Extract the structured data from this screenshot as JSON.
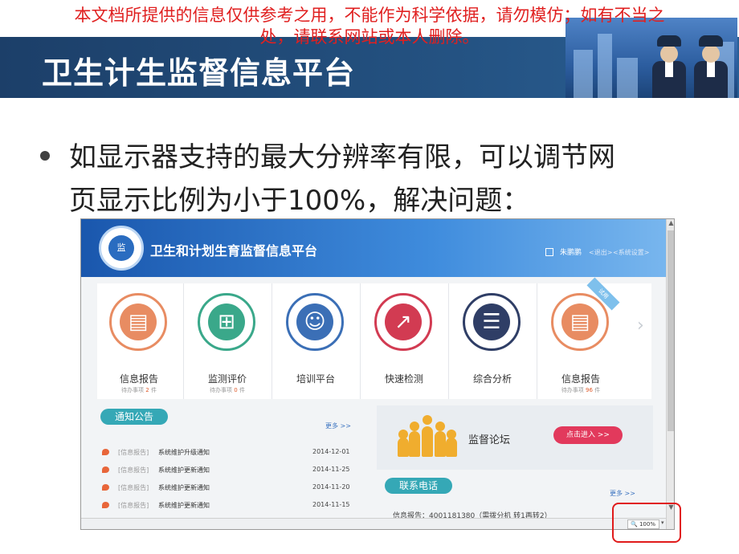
{
  "slide": {
    "disclaimer_line1": "本文档所提供的信息仅供参考之用，不能作为科学依据，请勿模仿；如有不当之",
    "disclaimer_line2": "处，请联系网站或本人删除。",
    "title": "卫生计生监督信息平台",
    "bullet_line1": "如显示器支持的最大分辨率有限，可以调节网",
    "bullet_line2": "页显示比例为小于100%，解决问题："
  },
  "site": {
    "title": "卫生和计划生育监督信息平台",
    "logo_text": "监",
    "user_name": "朱鹏鹏",
    "logout": "<退出>",
    "settings": "<系统设置>"
  },
  "tiles": [
    {
      "label": "信息报告",
      "sub_prefix": "待办事项",
      "count": "2",
      "sub_suffix": "件",
      "icon": "report-icon",
      "color": "#e88c62"
    },
    {
      "label": "监测评价",
      "sub_prefix": "待办事项",
      "count": "0",
      "sub_suffix": "件",
      "icon": "presentation-icon",
      "color": "#3aa88a"
    },
    {
      "label": "培训平台",
      "sub_prefix": "",
      "count": "",
      "sub_suffix": "",
      "icon": "trainer-icon",
      "color": "#3b6fb6"
    },
    {
      "label": "快速检测",
      "sub_prefix": "",
      "count": "",
      "sub_suffix": "",
      "icon": "chart-up-icon",
      "color": "#d23b52"
    },
    {
      "label": "综合分析",
      "sub_prefix": "",
      "count": "",
      "sub_suffix": "",
      "icon": "newspaper-icon",
      "color": "#2f3e66"
    },
    {
      "label": "信息报告",
      "sub_prefix": "待办事项",
      "count": "96",
      "sub_suffix": "件",
      "icon": "report-icon",
      "color": "#e88c62"
    }
  ],
  "ribbon": "试用",
  "notice": {
    "title": "通知公告",
    "more": "更多 >>",
    "items": [
      {
        "category": "[信息报告]",
        "title": "系统维护升级通知",
        "date": "2014-12-01"
      },
      {
        "category": "[信息报告]",
        "title": "系统维护更新通知",
        "date": "2014-11-25"
      },
      {
        "category": "[信息报告]",
        "title": "系统维护更新通知",
        "date": "2014-11-20"
      },
      {
        "category": "[信息报告]",
        "title": "系统维护更新通知",
        "date": "2014-11-15"
      }
    ]
  },
  "forum": {
    "title": "监督论坛",
    "enter": "点击进入 >>"
  },
  "contact": {
    "title": "联系电话",
    "more": "更多 >>",
    "phone": "信息报告：4001181380（需拨分机 转1再转2）"
  },
  "browser": {
    "zoom": "100%"
  }
}
